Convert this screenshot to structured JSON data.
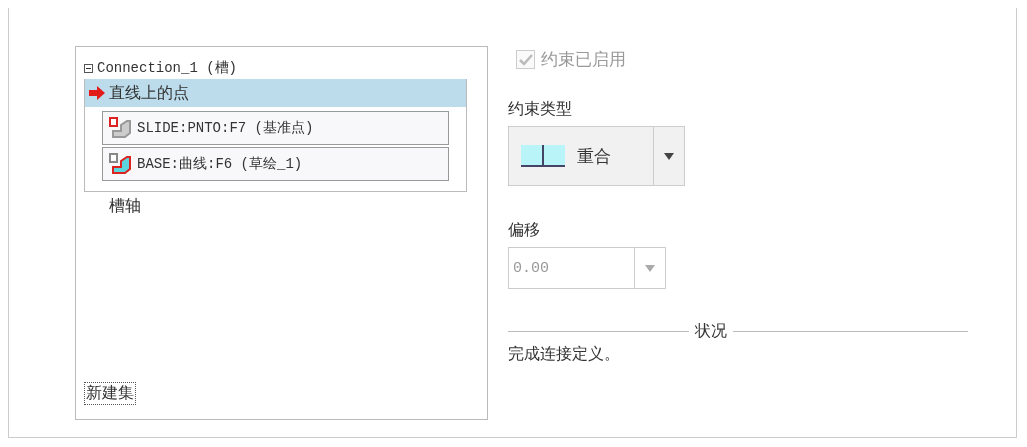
{
  "tree": {
    "label": "Connection_1 (槽)",
    "expanded": true,
    "children": [
      {
        "label": "直线上的点",
        "selected": true,
        "references": [
          {
            "label": "SLIDE:PNTO:F7 (基准点)",
            "kind": "slide"
          },
          {
            "label": "BASE:曲线:F6 (草绘_1)",
            "kind": "base"
          }
        ]
      },
      {
        "label": "槽轴",
        "selected": false
      }
    ]
  },
  "new_set_button": "新建集",
  "constraint_enabled": {
    "label": "约束已启用",
    "checked": true,
    "disabled": true
  },
  "constraint_type": {
    "label": "约束类型",
    "value": "重合"
  },
  "offset": {
    "label": "偏移",
    "value": "0.00",
    "disabled": true
  },
  "status": {
    "title": "状况",
    "message": "完成连接定义。"
  }
}
